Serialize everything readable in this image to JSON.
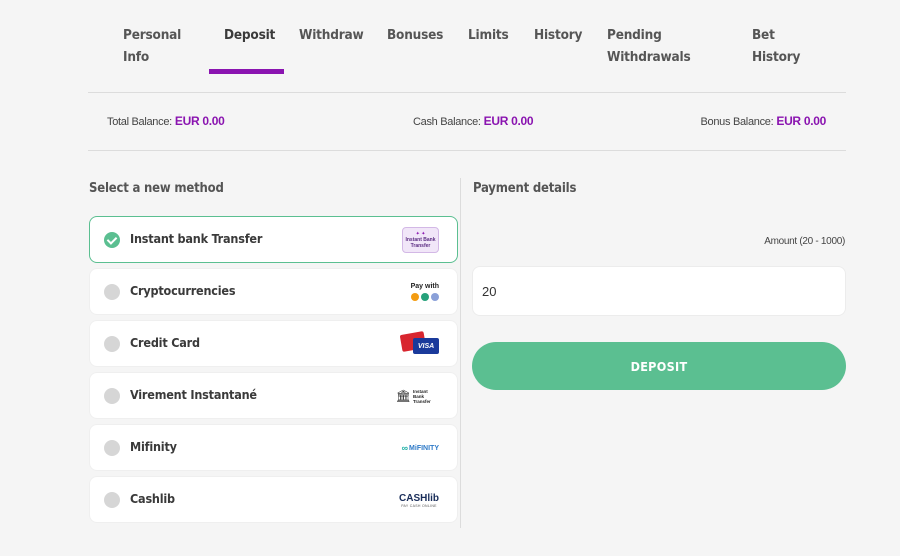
{
  "tabs": [
    {
      "line1": "Personal",
      "line2": "Info"
    },
    {
      "line1": "Deposit",
      "line2": ""
    },
    {
      "line1": "Withdraw",
      "line2": ""
    },
    {
      "line1": "Bonuses",
      "line2": ""
    },
    {
      "line1": "Limits",
      "line2": ""
    },
    {
      "line1": "History",
      "line2": ""
    },
    {
      "line1": "Pending",
      "line2": "Withdrawals"
    },
    {
      "line1": "Bet",
      "line2": "History"
    }
  ],
  "active_tab": "Deposit",
  "balances": {
    "total_label": "Total Balance:",
    "total_value": "EUR 0.00",
    "cash_label": "Cash Balance:",
    "cash_value": "EUR 0.00",
    "bonus_label": "Bonus Balance:",
    "bonus_value": "EUR 0.00"
  },
  "methods_title": "Select a new method",
  "methods": [
    {
      "label": "Instant bank Transfer",
      "selected": true,
      "logo_text": "Instant Bank Transfer",
      "icon": "instant-bank-transfer-logo"
    },
    {
      "label": "Cryptocurrencies",
      "selected": false,
      "logo_text": "Pay with",
      "icon": "crypto-logo"
    },
    {
      "label": "Credit Card",
      "selected": false,
      "logo_text": "VISA",
      "icon": "visa-card-logo"
    },
    {
      "label": "Virement Instantané",
      "selected": false,
      "logo_text": "Instant Bank Transfer",
      "icon": "bank-building-logo"
    },
    {
      "label": "Mifinity",
      "selected": false,
      "logo_text": "MiFINITY",
      "icon": "mifinity-logo"
    },
    {
      "label": "Cashlib",
      "selected": false,
      "logo_text": "CASHlib",
      "logo_sub": "PAY CASH ONLINE",
      "icon": "cashlib-logo"
    }
  ],
  "payment": {
    "title": "Payment details",
    "amount_label": "Amount (20 - 1000)",
    "amount_value": "20",
    "deposit_label": "DEPOSIT"
  },
  "colors": {
    "accent": "#8a14b0",
    "green": "#5bbf91"
  }
}
